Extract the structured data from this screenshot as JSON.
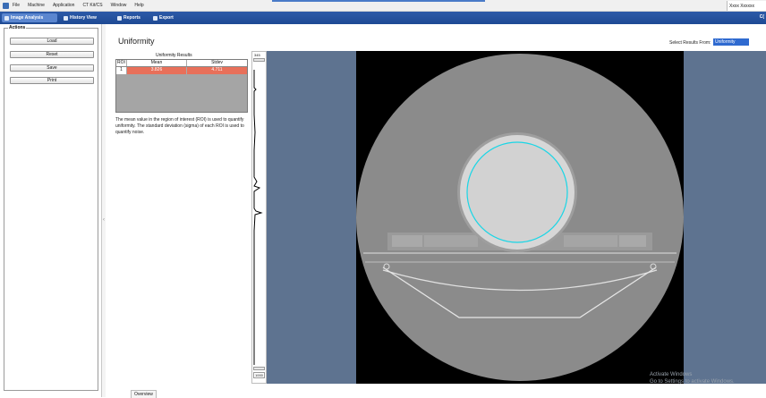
{
  "menubar": {
    "items": [
      "File",
      "Machine",
      "Application",
      "CT Kit/CS",
      "Window",
      "Help"
    ],
    "user": "Xxxx Xxxxxx"
  },
  "toolbar": {
    "tabs": [
      "Image Analysis",
      "History View",
      "Reports",
      "Export"
    ],
    "right_label": "C("
  },
  "actions": {
    "title": "Actions",
    "buttons": [
      "Load",
      "Reset",
      "Save",
      "Print"
    ]
  },
  "main": {
    "title": "Uniformity",
    "series_label": "Select Results From:",
    "series_value": "Uniformity",
    "table_caption": "Uniformity Results",
    "table": {
      "headers": [
        "ROI",
        "Mean",
        "Stdev"
      ],
      "rows": [
        [
          "1",
          "3.826",
          "4.711"
        ]
      ]
    },
    "description": "The mean value in the region of interest (ROI) is used to quantify uniformity. The standard deviation (sigma) of each ROI is used to quantify noise."
  },
  "profile": {
    "top_label": "345",
    "bottom_label": "1000"
  },
  "watermark": {
    "line1": "Activate Windows",
    "line2": "Go to Settings to activate Windows."
  },
  "bottom_tab": "Overview",
  "colors": {
    "toolbar": "#2d5aa8",
    "roi_highlight": "#e8705a",
    "roi_circle": "#19d6e6",
    "viewer_bg": "#5e7390"
  }
}
